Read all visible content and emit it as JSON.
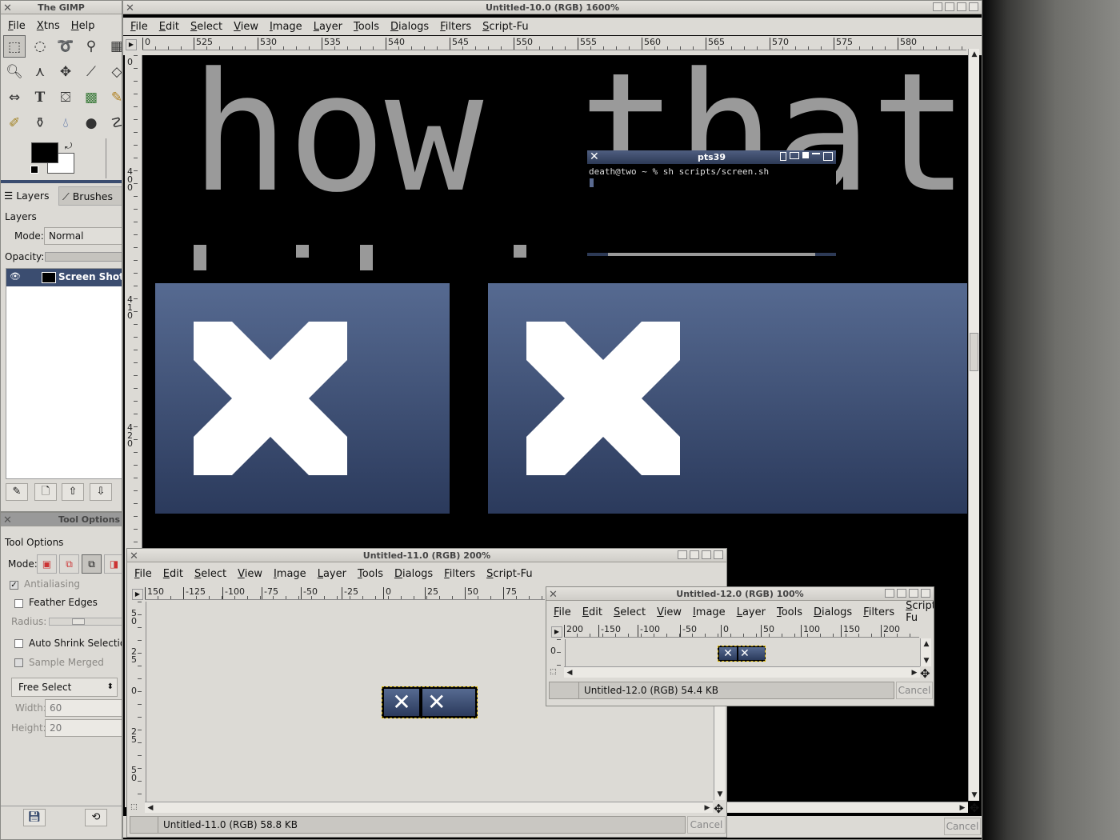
{
  "toolbox": {
    "title": "The GIMP",
    "menu": [
      "File",
      "Xtns",
      "Help"
    ],
    "tabs": {
      "layers": "Layers",
      "brushes": "Brushes"
    },
    "layers_heading": "Layers",
    "mode_label": "Mode:",
    "mode_value": "Normal",
    "opacity_label": "Opacity:",
    "layer_name": "Screen Shot",
    "tools": [
      "rect-select",
      "ellipse-select",
      "free-select",
      "fuzzy-select",
      "zoom",
      "paths",
      "move",
      "paintbrush",
      "scale",
      "text",
      "bucket-fill",
      "blend",
      "pencil",
      "clone",
      "dodge",
      "ink"
    ]
  },
  "tool_options": {
    "window_title": "Tool Options",
    "heading": "Tool Options",
    "mode_label": "Mode:",
    "antialiasing": "Antialiasing",
    "feather_edges": "Feather Edges",
    "radius_label": "Radius:",
    "auto_shrink": "Auto Shrink Selection",
    "sample_merged": "Sample Merged",
    "select_value": "Free Select",
    "width_label": "Width:",
    "width_value": "60",
    "height_label": "Height:",
    "height_value": "20"
  },
  "main_image": {
    "title": "Untitled-10.0 (RGB) 1600%",
    "menu": [
      "File",
      "Edit",
      "Select",
      "View",
      "Image",
      "Layer",
      "Tools",
      "Dialogs",
      "Filters",
      "Script-Fu"
    ],
    "hruler": [
      "0",
      "525",
      "530",
      "535",
      "540",
      "545",
      "550",
      "555",
      "560",
      "565",
      "570",
      "575",
      "580"
    ],
    "vruler": [
      "0",
      "400",
      "410",
      "420"
    ],
    "canvas_text": "how that m",
    "cancel": "Cancel"
  },
  "terminal": {
    "title": "pts39",
    "prompt": "death@two ~ % sh scripts/screen.sh"
  },
  "image11": {
    "title": "Untitled-11.0 (RGB) 200%",
    "menu": [
      "File",
      "Edit",
      "Select",
      "View",
      "Image",
      "Layer",
      "Tools",
      "Dialogs",
      "Filters",
      "Script-Fu"
    ],
    "hruler": [
      "150",
      "-125",
      "-100",
      "-75",
      "-50",
      "-25",
      "0",
      "25",
      "50",
      "75"
    ],
    "vruler": [
      "50",
      "25",
      "0",
      "25",
      "50"
    ],
    "status": "Untitled-11.0 (RGB) 58.8 KB",
    "cancel": "Cancel"
  },
  "image12": {
    "title": "Untitled-12.0 (RGB) 100%",
    "menu": [
      "File",
      "Edit",
      "Select",
      "View",
      "Image",
      "Layer",
      "Tools",
      "Dialogs",
      "Filters",
      "Script-Fu"
    ],
    "hruler": [
      "200",
      "-150",
      "-100",
      "-50",
      "0",
      "50",
      "100",
      "150",
      "200"
    ],
    "vruler": [
      "0"
    ],
    "status": "Untitled-12.0 (RGB) 54.4 KB",
    "cancel": "Cancel"
  }
}
